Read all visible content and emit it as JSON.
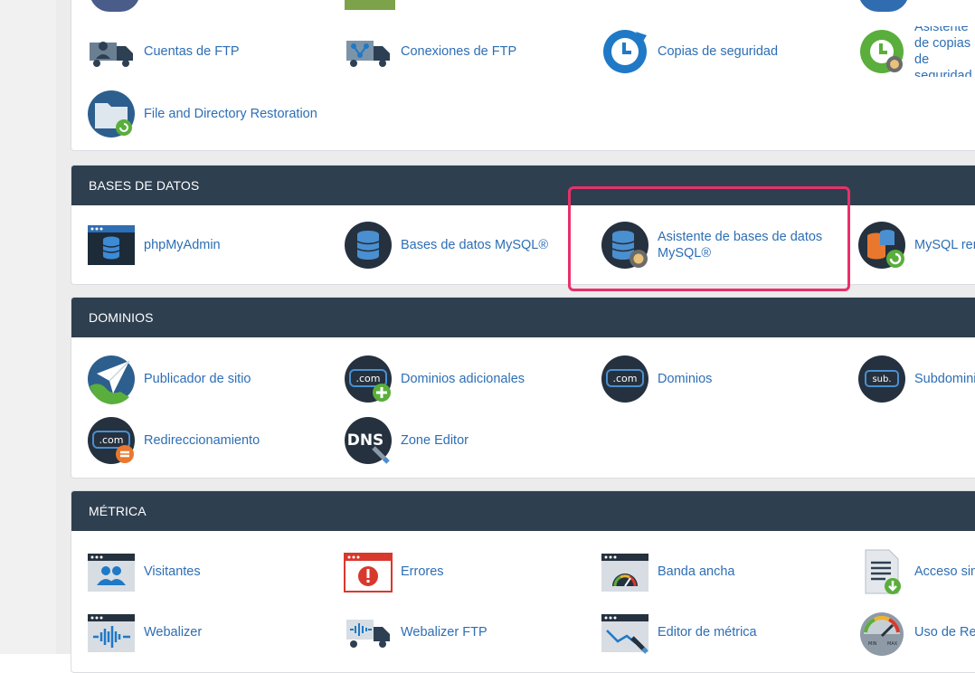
{
  "files": {
    "items": [
      {
        "label": "Cuentas de FTP"
      },
      {
        "label": "Conexiones de FTP"
      },
      {
        "label": "Copias de seguridad"
      },
      {
        "label": "Asistente de copias de seguridad"
      },
      {
        "label": "File and Directory Restoration"
      }
    ]
  },
  "databases": {
    "title": "BASES DE DATOS",
    "items": [
      {
        "label": "phpMyAdmin"
      },
      {
        "label": "Bases de datos MySQL®"
      },
      {
        "label": "Asistente de bases de datos MySQL®"
      },
      {
        "label": "MySQL remoto"
      }
    ]
  },
  "domains": {
    "title": "DOMINIOS",
    "items": [
      {
        "label": "Publicador de sitio"
      },
      {
        "label": "Dominios adicionales"
      },
      {
        "label": "Dominios"
      },
      {
        "label": "Subdominios"
      },
      {
        "label": "Redireccionamiento"
      },
      {
        "label": "Zone Editor"
      }
    ],
    "icon_text": {
      "com": ".com",
      "sub": "sub.",
      "dns": "DNS"
    }
  },
  "metrics": {
    "title": "MÉTRICA",
    "items": [
      {
        "label": "Visitantes"
      },
      {
        "label": "Errores"
      },
      {
        "label": "Banda ancha"
      },
      {
        "label": "Acceso sin procesar"
      },
      {
        "label": "Webalizer"
      },
      {
        "label": "Webalizer FTP"
      },
      {
        "label": "Editor de métrica"
      },
      {
        "label": "Uso de Recursos"
      }
    ],
    "gauge_text": {
      "min": "MIN",
      "max": "MAX"
    }
  },
  "colors": {
    "header": "#2e3f50",
    "link": "#2d6eb5",
    "highlight": "#e8306a",
    "icon_navy": "#2d3f52",
    "icon_blue": "#1f79c6",
    "icon_green": "#5aae3c",
    "icon_red": "#d9382c"
  }
}
